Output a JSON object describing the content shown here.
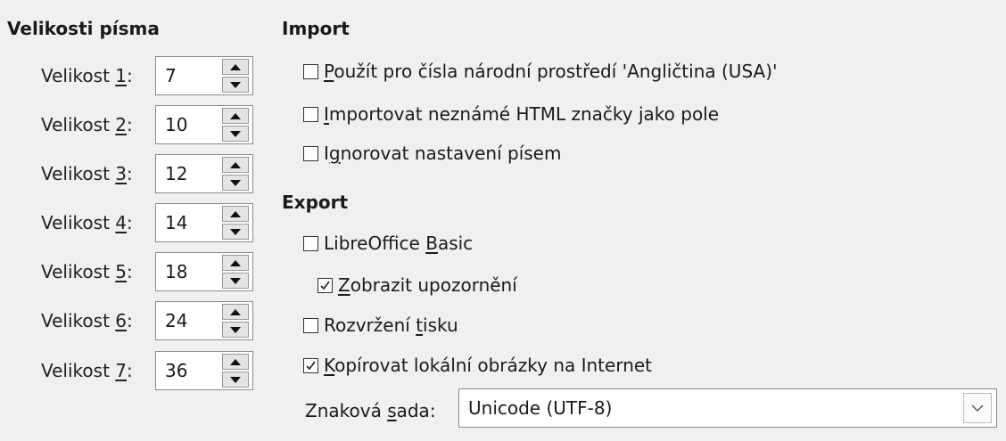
{
  "font_sizes": {
    "title": "Velikosti písma",
    "rows": [
      {
        "label_prefix": "Velikost ",
        "label_key": "1",
        "label_suffix": ":",
        "value": "7"
      },
      {
        "label_prefix": "Velikost ",
        "label_key": "2",
        "label_suffix": ":",
        "value": "10"
      },
      {
        "label_prefix": "Velikost ",
        "label_key": "3",
        "label_suffix": ":",
        "value": "12"
      },
      {
        "label_prefix": "Velikost ",
        "label_key": "4",
        "label_suffix": ":",
        "value": "14"
      },
      {
        "label_prefix": "Velikost ",
        "label_key": "5",
        "label_suffix": ":",
        "value": "18"
      },
      {
        "label_prefix": "Velikost ",
        "label_key": "6",
        "label_suffix": ":",
        "value": "24"
      },
      {
        "label_prefix": "Velikost ",
        "label_key": "7",
        "label_suffix": ":",
        "value": "36"
      }
    ]
  },
  "import": {
    "title": "Import",
    "options": [
      {
        "key": "P",
        "rest": "oužít pro čísla národní prostředí 'Angličtina (USA)'",
        "checked": false
      },
      {
        "key": "I",
        "rest": "mportovat neznámé HTML značky jako pole",
        "checked": false
      },
      {
        "pre": "I",
        "key": "g",
        "rest": "norovat nastavení písem",
        "checked": false
      }
    ]
  },
  "export": {
    "title": "Export",
    "options": [
      {
        "pre": "LibreOffice ",
        "key": "B",
        "rest": "asic",
        "checked": false
      },
      {
        "key": "Z",
        "rest": "obrazit upozornění",
        "checked": true
      },
      {
        "pre": "Rozvržení ",
        "key": "t",
        "rest": "isku",
        "checked": false
      },
      {
        "key": "K",
        "rest": "opírovat lokální obrázky na Internet",
        "checked": true
      }
    ],
    "charset": {
      "label_pre": "Znaková ",
      "label_key": "s",
      "label_rest": "ada:",
      "value": "Unicode (UTF-8)"
    }
  }
}
